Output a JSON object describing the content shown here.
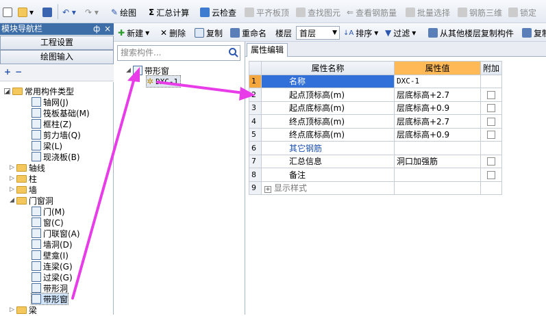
{
  "toolbar1": {
    "draw": "绘图",
    "summary": "汇总计算",
    "cloud_check": "云检查",
    "flush_top": "平齐板顶",
    "find_element": "查找图元",
    "view_rebar": "查看钢筋量",
    "batch_select": "批量选择",
    "rebar_3d": "钢筋三维",
    "lock": "锁定"
  },
  "toolbar2": {
    "new": "新建",
    "delete": "删除",
    "copy": "复制",
    "rename": "重命名",
    "floor_label": "楼层",
    "floor_value": "首层",
    "sort": "排序",
    "filter": "过滤",
    "copy_from_floor": "从其他楼层复制构件",
    "copy_more": "复制"
  },
  "nav": {
    "title": "模块导航栏",
    "pin": "ф",
    "close": "×",
    "project_settings": "工程设置",
    "drawing_input": "绘图输入",
    "tree": {
      "common": "常用构件类型",
      "common_items": [
        "轴网(J)",
        "筏板基础(M)",
        "框柱(Z)",
        "剪力墙(Q)",
        "梁(L)",
        "现浇板(B)"
      ],
      "axis": "轴线",
      "column": "柱",
      "wall": "墙",
      "door_window": "门窗洞",
      "dw_items": [
        "门(M)",
        "窗(C)",
        "门联窗(A)",
        "墙洞(D)",
        "壁龛(I)",
        "连梁(G)",
        "过梁(G)",
        "带形洞",
        "带形窗"
      ],
      "beam": "梁"
    }
  },
  "middle": {
    "search_placeholder": "搜索构件...",
    "group": "带形窗",
    "item": "DXC-1"
  },
  "props": {
    "tab": "属性编辑",
    "col_name": "属性名称",
    "col_value": "属性值",
    "col_extra": "附加",
    "rows": [
      {
        "n": "1",
        "name": "名称",
        "value": "DXC-1"
      },
      {
        "n": "2",
        "name": "起点顶标高(m)",
        "value": "层底标高+2.7"
      },
      {
        "n": "3",
        "name": "起点底标高(m)",
        "value": "层底标高+0.9"
      },
      {
        "n": "4",
        "name": "终点顶标高(m)",
        "value": "层底标高+2.7"
      },
      {
        "n": "5",
        "name": "终点底标高(m)",
        "value": "层底标高+0.9"
      },
      {
        "n": "6",
        "name": "其它钢筋",
        "value": ""
      },
      {
        "n": "7",
        "name": "汇总信息",
        "value": "洞口加强筋"
      },
      {
        "n": "8",
        "name": "备注",
        "value": ""
      },
      {
        "n": "9",
        "name": "显示样式",
        "value": ""
      }
    ]
  },
  "colors": {
    "annotation_arrow": "#e83ce8",
    "selected_row": "#3070d8",
    "value_header": "#ffb957"
  }
}
